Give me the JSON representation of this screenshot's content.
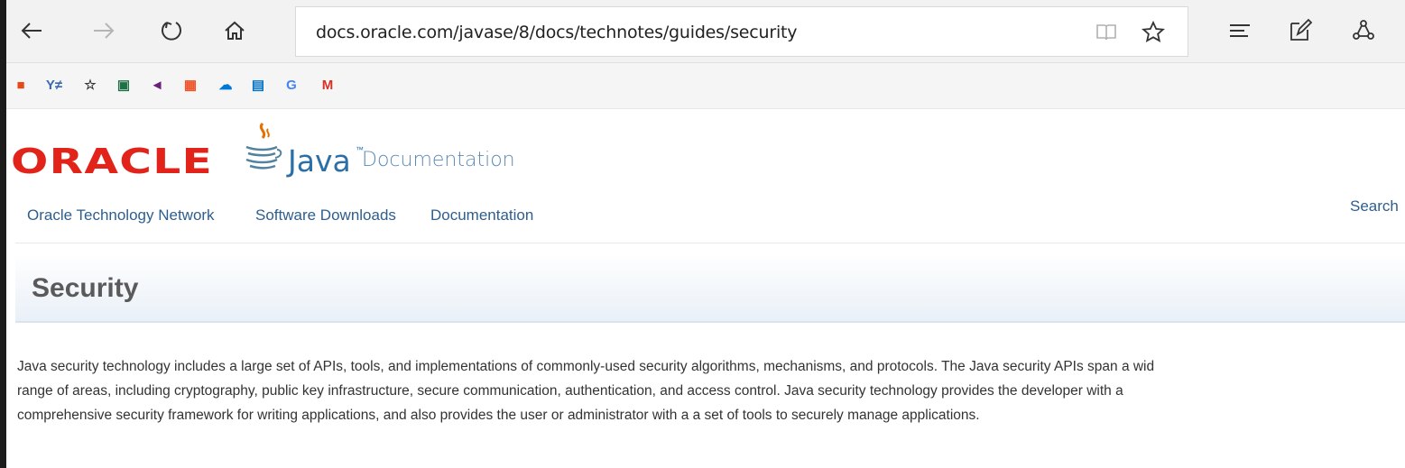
{
  "browser": {
    "url": "docs.oracle.com/javase/8/docs/technotes/guides/security",
    "toolbar_icons": [
      "back-arrow-icon",
      "forward-arrow-icon",
      "refresh-icon",
      "home-icon",
      "reading-view-icon",
      "favorite-star-icon",
      "hub-icon",
      "web-note-icon",
      "share-icon"
    ]
  },
  "favorites": [
    {
      "name": "office-icon",
      "glyph": "■",
      "color": "#e64a19"
    },
    {
      "name": "yammer-icon",
      "glyph": "Y≠",
      "color": "#396ab1"
    },
    {
      "name": "star-icon",
      "glyph": "☆",
      "color": "#333333"
    },
    {
      "name": "excel-icon",
      "glyph": "▣",
      "color": "#1e7145"
    },
    {
      "name": "visual-studio-icon",
      "glyph": "◄",
      "color": "#68217a"
    },
    {
      "name": "windows-store-icon",
      "glyph": "▦",
      "color": "#f25022"
    },
    {
      "name": "onedrive-icon",
      "glyph": "☁",
      "color": "#0078d7"
    },
    {
      "name": "outlook-icon",
      "glyph": "▤",
      "color": "#0072c6"
    },
    {
      "name": "google-icon",
      "glyph": "G",
      "color": "#4285f4"
    },
    {
      "name": "gmail-icon",
      "glyph": "M",
      "color": "#d93025"
    }
  ],
  "header": {
    "oracle_logo": "ORACLE",
    "java_word": "Java",
    "java_tm": "™",
    "doc_word": "Documentation"
  },
  "nav": {
    "otn": "Oracle Technology Network",
    "downloads": "Software Downloads",
    "documentation": "Documentation",
    "search": "Search"
  },
  "content": {
    "title": "Security",
    "paragraph_lines": [
      "Java security technology includes a large set of APIs, tools, and implementations of commonly-used security algorithms, mechanisms, and protocols. The Java security APIs span a wid",
      "range of areas, including cryptography, public key infrastructure, secure communication, authentication, and access control. Java security technology provides the developer with a",
      "comprehensive security framework for writing applications, and also provides the user or administrator with a a set of tools to securely manage applications."
    ]
  },
  "colors": {
    "oracle_red": "#e2231a",
    "java_blue": "#2c6fa6",
    "link_blue": "#2e5e8e"
  }
}
